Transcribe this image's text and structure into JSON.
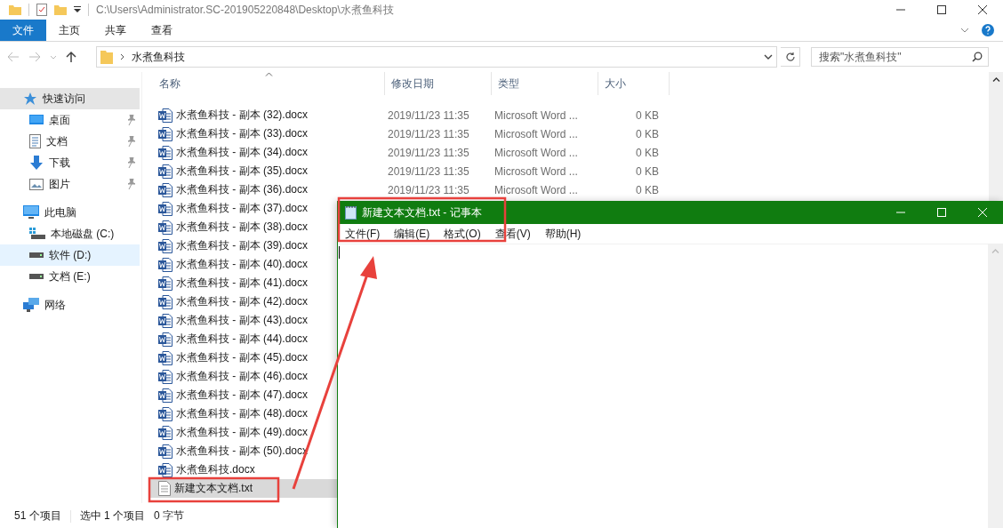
{
  "explorer": {
    "title": "C:\\Users\\Administrator.SC-201905220848\\Desktop\\水煮鱼科技",
    "ribbon_tabs": [
      {
        "label": "文件",
        "selected": true
      },
      {
        "label": "主页",
        "selected": false
      },
      {
        "label": "共享",
        "selected": false
      },
      {
        "label": "查看",
        "selected": false
      }
    ],
    "address": {
      "crumbs": [
        "水煮鱼科技"
      ]
    },
    "search": {
      "placeholder": "搜索\"水煮鱼科技\""
    },
    "nav": [
      {
        "label": "快速访问",
        "kind": "star",
        "hovered": true,
        "selected": false,
        "children": [
          {
            "label": "桌面",
            "kind": "desktop",
            "pinned": true,
            "hovered": false,
            "selected": false
          },
          {
            "label": "文档",
            "kind": "document",
            "pinned": true,
            "hovered": false,
            "selected": false
          },
          {
            "label": "下载",
            "kind": "download",
            "pinned": true,
            "hovered": false,
            "selected": false
          },
          {
            "label": "图片",
            "kind": "picture",
            "pinned": true,
            "hovered": false,
            "selected": false
          }
        ]
      },
      {
        "label": "此电脑",
        "kind": "pc",
        "hovered": false,
        "selected": false,
        "children": [
          {
            "label": "本地磁盘 (C:)",
            "kind": "system",
            "pinned": false,
            "hovered": false,
            "selected": false
          },
          {
            "label": "软件 (D:)",
            "kind": "drive",
            "pinned": false,
            "hovered": false,
            "selected": true
          },
          {
            "label": "文档 (E:)",
            "kind": "drive",
            "pinned": false,
            "hovered": false,
            "selected": false
          }
        ]
      },
      {
        "label": "网络",
        "kind": "network",
        "hovered": false,
        "selected": false
      }
    ],
    "columns": [
      "名称",
      "修改日期",
      "类型",
      "大小"
    ],
    "files": [
      {
        "name": "水煮鱼科技 - 副本 (32).docx",
        "kind": "word",
        "date": "2019/11/23 11:35",
        "type": "Microsoft Word ...",
        "size": "0 KB",
        "selected": false
      },
      {
        "name": "水煮鱼科技 - 副本 (33).docx",
        "kind": "word",
        "date": "2019/11/23 11:35",
        "type": "Microsoft Word ...",
        "size": "0 KB",
        "selected": false
      },
      {
        "name": "水煮鱼科技 - 副本 (34).docx",
        "kind": "word",
        "date": "2019/11/23 11:35",
        "type": "Microsoft Word ...",
        "size": "0 KB",
        "selected": false
      },
      {
        "name": "水煮鱼科技 - 副本 (35).docx",
        "kind": "word",
        "date": "2019/11/23 11:35",
        "type": "Microsoft Word ...",
        "size": "0 KB",
        "selected": false
      },
      {
        "name": "水煮鱼科技 - 副本 (36).docx",
        "kind": "word",
        "date": "2019/11/23 11:35",
        "type": "Microsoft Word ...",
        "size": "0 KB",
        "selected": false
      },
      {
        "name": "水煮鱼科技 - 副本 (37).docx",
        "kind": "word",
        "selected": false
      },
      {
        "name": "水煮鱼科技 - 副本 (38).docx",
        "kind": "word",
        "selected": false
      },
      {
        "name": "水煮鱼科技 - 副本 (39).docx",
        "kind": "word",
        "selected": false
      },
      {
        "name": "水煮鱼科技 - 副本 (40).docx",
        "kind": "word",
        "selected": false
      },
      {
        "name": "水煮鱼科技 - 副本 (41).docx",
        "kind": "word",
        "selected": false
      },
      {
        "name": "水煮鱼科技 - 副本 (42).docx",
        "kind": "word",
        "selected": false
      },
      {
        "name": "水煮鱼科技 - 副本 (43).docx",
        "kind": "word",
        "selected": false
      },
      {
        "name": "水煮鱼科技 - 副本 (44).docx",
        "kind": "word",
        "selected": false
      },
      {
        "name": "水煮鱼科技 - 副本 (45).docx",
        "kind": "word",
        "selected": false
      },
      {
        "name": "水煮鱼科技 - 副本 (46).docx",
        "kind": "word",
        "selected": false
      },
      {
        "name": "水煮鱼科技 - 副本 (47).docx",
        "kind": "word",
        "selected": false
      },
      {
        "name": "水煮鱼科技 - 副本 (48).docx",
        "kind": "word",
        "selected": false
      },
      {
        "name": "水煮鱼科技 - 副本 (49).docx",
        "kind": "word",
        "selected": false
      },
      {
        "name": "水煮鱼科技 - 副本 (50).docx",
        "kind": "word",
        "selected": false
      },
      {
        "name": "水煮鱼科技.docx",
        "kind": "word",
        "selected": false
      },
      {
        "name": "新建文本文档.txt",
        "kind": "text",
        "selected": true
      }
    ],
    "status": {
      "count": "51 个项目",
      "selection": "选中 1 个项目",
      "size": "0 字节"
    }
  },
  "notepad": {
    "title": "新建文本文档.txt - 记事本",
    "menu": [
      "文件(F)",
      "编辑(E)",
      "格式(O)",
      "查看(V)",
      "帮助(H)"
    ]
  }
}
